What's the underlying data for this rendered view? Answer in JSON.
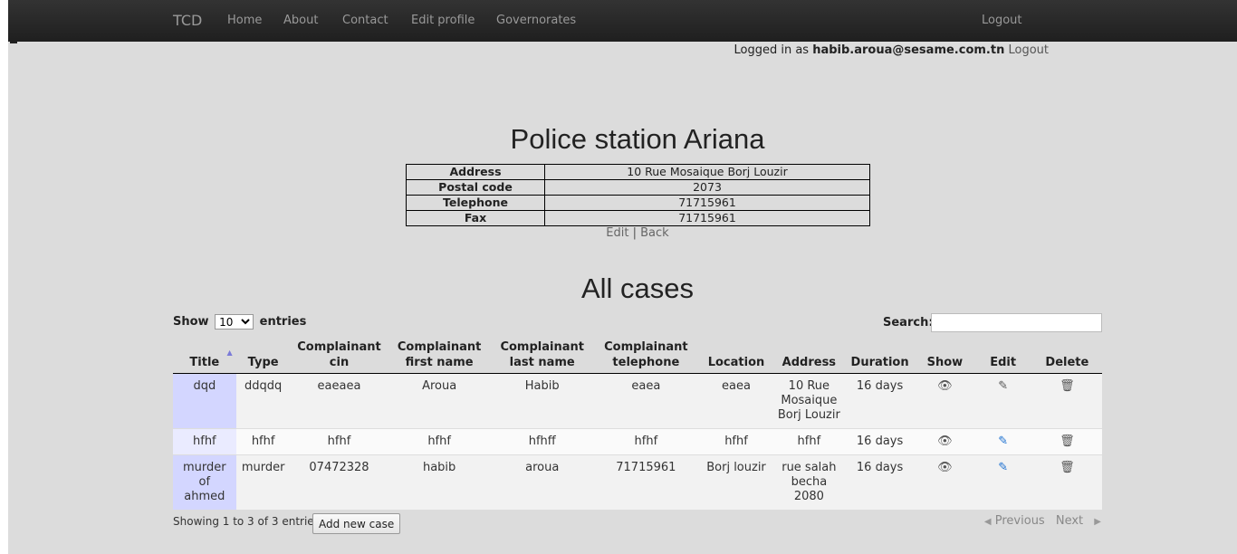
{
  "nav": {
    "brand": "TCD",
    "items": [
      "Home",
      "About",
      "Contact",
      "Edit profile",
      "Governorates"
    ],
    "logout": "Logout"
  },
  "session": {
    "prefix": "Logged in as",
    "user": "habib.aroua@sesame.com.tn",
    "logout": "Logout"
  },
  "station": {
    "title": "Police station Ariana",
    "rows": [
      {
        "label": "Address",
        "value": "10 Rue Mosaique Borj Louzir"
      },
      {
        "label": "Postal code",
        "value": "2073"
      },
      {
        "label": "Telephone",
        "value": "71715961"
      },
      {
        "label": "Fax",
        "value": "71715961"
      }
    ],
    "edit": "Edit",
    "sep": "|",
    "back": "Back"
  },
  "cases": {
    "title": "All cases",
    "show_label": "Show",
    "entries_value": "10",
    "entries_label": "entries",
    "search_label": "Search:",
    "headers": [
      "Title",
      "Type",
      "Complainant cin",
      "Complainant first name",
      "Complainant last name",
      "Complainant telephone",
      "Location",
      "Address",
      "Duration",
      "Show",
      "Edit",
      "Delete"
    ],
    "rows": [
      [
        "dqd",
        "ddqdq",
        "eaeaea",
        "Aroua",
        "Habib",
        "eaea",
        "eaea",
        "10 Rue Mosaique Borj Louzir",
        "16 days"
      ],
      [
        "hfhf",
        "hfhf",
        "hfhf",
        "hfhf",
        "hfhff",
        "hfhf",
        "hfhf",
        "hfhf",
        "16 days"
      ],
      [
        "murder of ahmed",
        "murder",
        "07472328",
        "habib",
        "aroua",
        "71715961",
        "Borj louzir",
        "rue salah becha 2080",
        "16 days"
      ]
    ],
    "info": "Showing 1 to 3 of 3 entries",
    "add_button": "Add new case",
    "previous": "Previous",
    "next": "Next"
  },
  "icons": {
    "show": "eye-icon",
    "edit": "pencil-icon",
    "delete": "trash-icon"
  },
  "colors": {
    "sorted_column": "#d3d6ff",
    "edit_icon_blue": "#1a6fd0"
  }
}
